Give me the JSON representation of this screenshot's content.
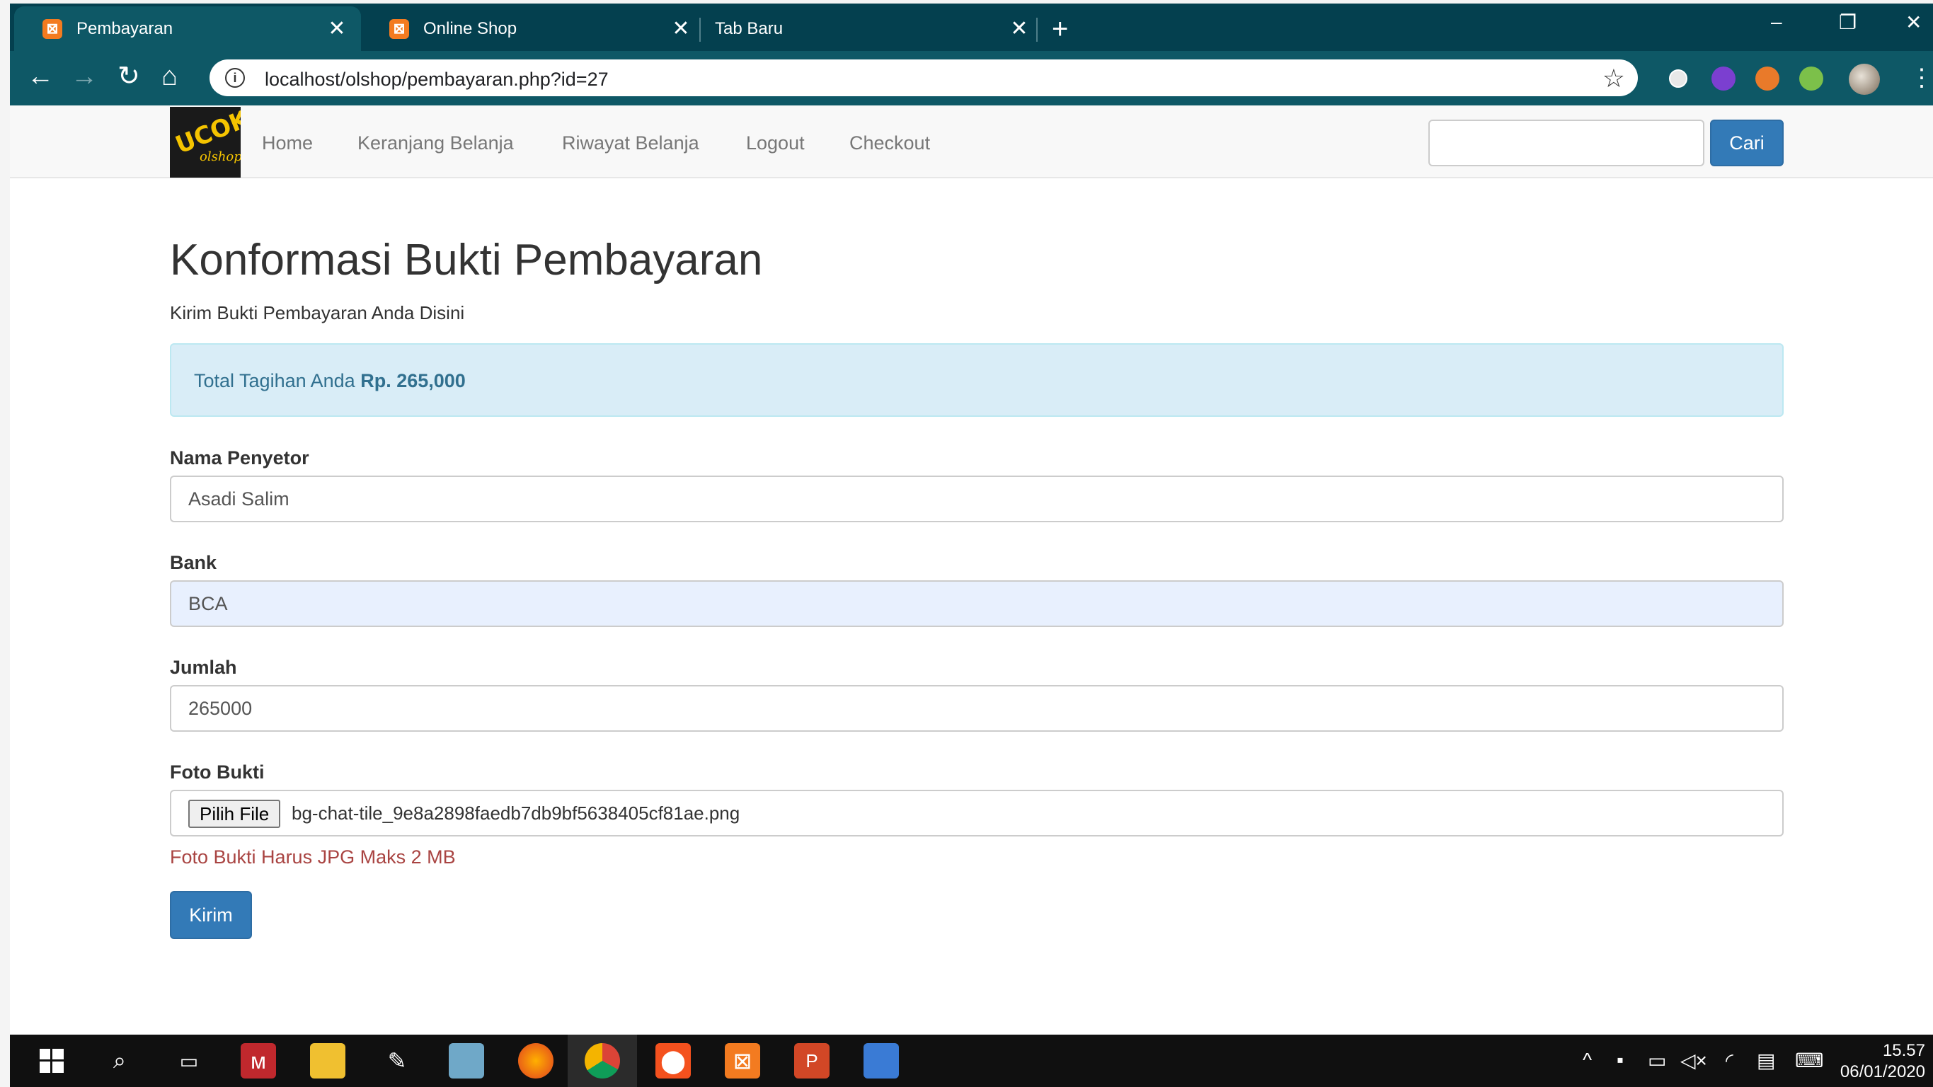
{
  "browser": {
    "tabs": [
      {
        "title": "Pembayaran",
        "active": true
      },
      {
        "title": "Online Shop",
        "active": false
      },
      {
        "title": "Tab Baru",
        "active": false
      }
    ],
    "url": "localhost/olshop/pembayaran.php?id=27",
    "colors": {
      "tabstrip": "#04404f",
      "toolbar": "#0e5866"
    }
  },
  "site": {
    "logo": {
      "line1": "UCOK",
      "line2": "olshop"
    },
    "nav": [
      "Home",
      "Keranjang Belanja",
      "Riwayat Belanja",
      "Logout",
      "Checkout"
    ],
    "search": {
      "value": "",
      "button": "Cari"
    }
  },
  "page": {
    "title": "Konformasi Bukti Pembayaran",
    "subtitle": "Kirim Bukti Pembayaran Anda Disini",
    "alert": {
      "text": "Total Tagihan Anda ",
      "amount": "Rp. 265,000"
    },
    "form": {
      "nama_label": "Nama Penyetor",
      "nama_value": "Asadi Salim",
      "bank_label": "Bank",
      "bank_value": "BCA",
      "jumlah_label": "Jumlah",
      "jumlah_value": "265000",
      "foto_label": "Foto Bukti",
      "file_button": "Pilih File",
      "file_name": "bg-chat-tile_9e8a2898faedb7db9bf5638405cf81ae.png",
      "foto_help": "Foto Bukti Harus JPG Maks 2 MB",
      "submit": "Kirim"
    },
    "colors": {
      "primary": "#337ab7",
      "info_bg": "#d9edf7",
      "danger_text": "#a94442"
    }
  },
  "taskbar": {
    "icons": [
      "windows-start-icon",
      "search-icon",
      "task-view-icon",
      "app-icon",
      "file-explorer-icon",
      "paint-icon",
      "notepad-icon",
      "firefox-icon",
      "chrome-icon",
      "app-icon",
      "xampp-icon",
      "powerpoint-icon",
      "photos-icon"
    ],
    "time": "15.57",
    "date": "06/01/2020"
  }
}
